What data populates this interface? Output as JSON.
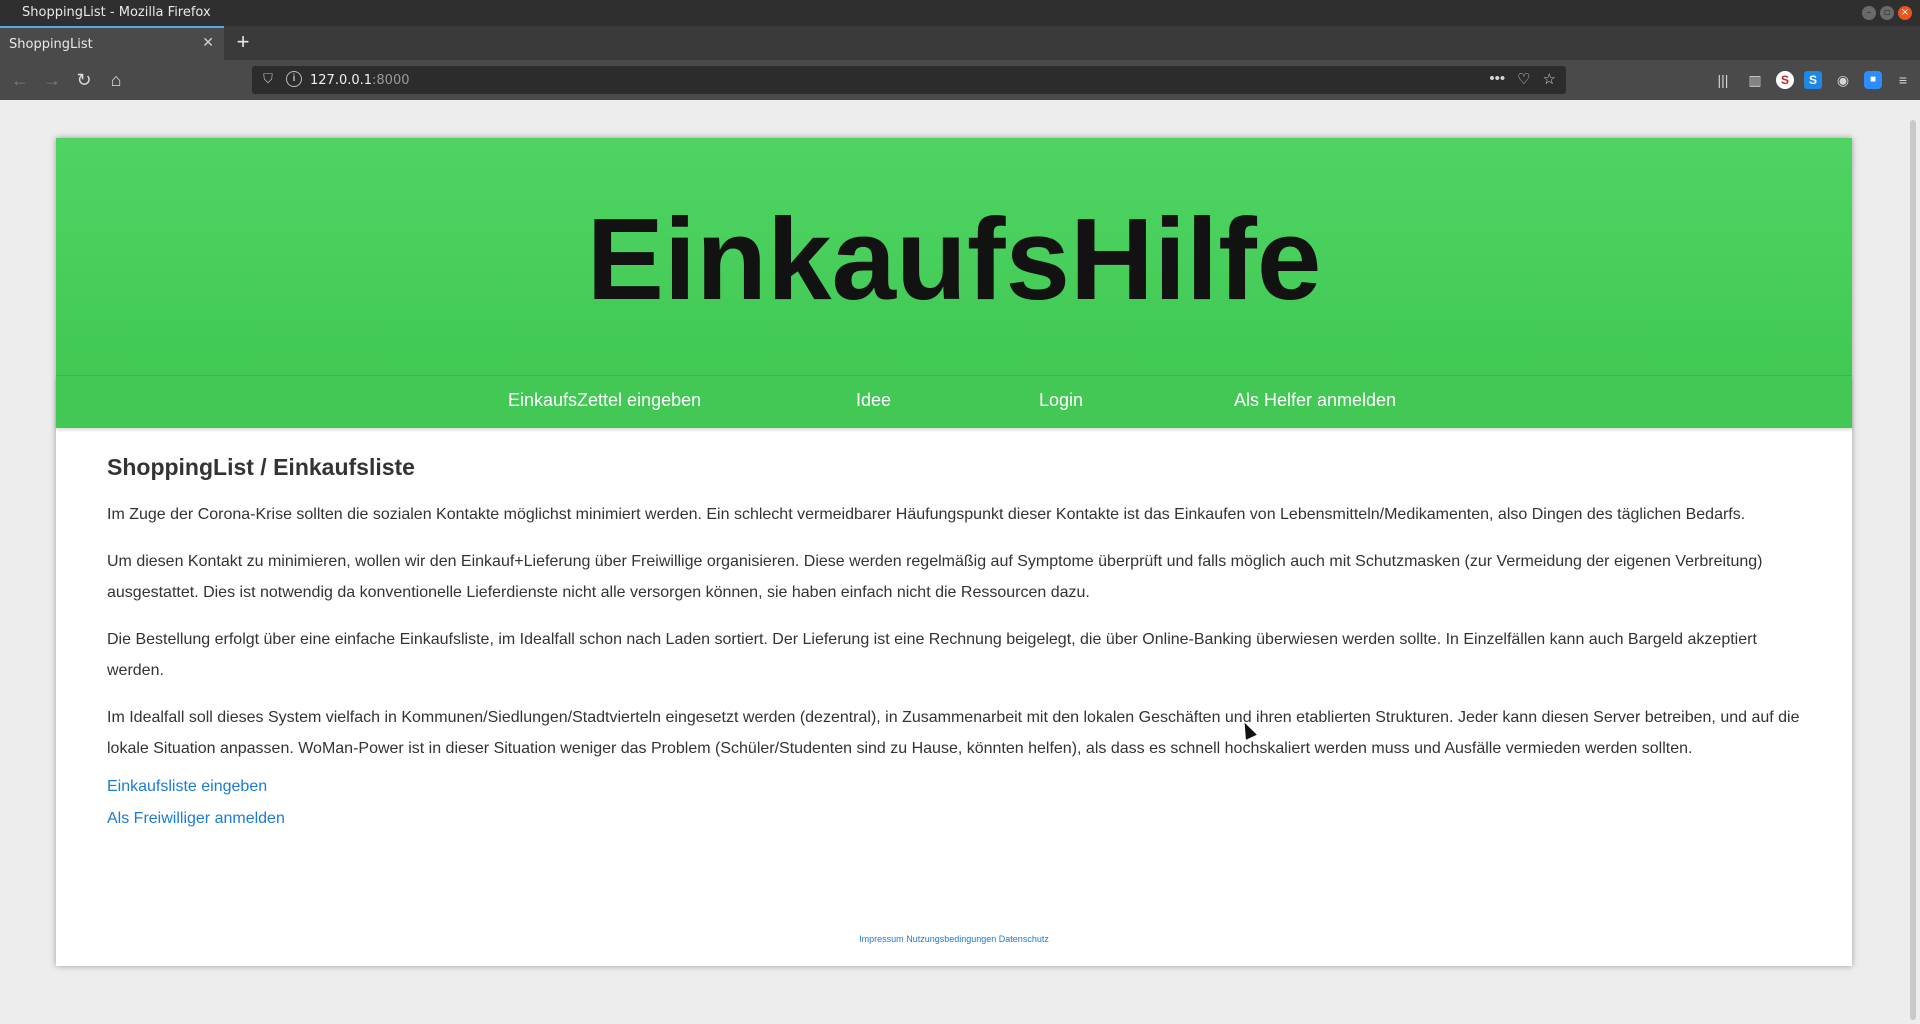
{
  "window": {
    "title": "ShoppingList - Mozilla Firefox"
  },
  "tab": {
    "title": "ShoppingList",
    "close": "✕"
  },
  "newtab": "+",
  "nav": {
    "back": "←",
    "forward": "→",
    "reload": "↻",
    "home": "⌂"
  },
  "url": {
    "host": "127.0.0.1",
    "port": ":8000"
  },
  "url_actions": {
    "more": "•••",
    "pocket": "♡",
    "bookmark": "☆"
  },
  "hero": {
    "title": "EinkaufsHilfe"
  },
  "menu": [
    {
      "label": "EinkaufsZettel eingeben"
    },
    {
      "label": "Idee"
    },
    {
      "label": "Login"
    },
    {
      "label": "Als Helfer anmelden"
    }
  ],
  "main": {
    "heading": "ShoppingList / Einkaufsliste",
    "paragraphs": [
      "Im Zuge der Corona-Krise sollten die sozialen Kontakte möglichst minimiert werden. Ein schlecht vermeidbarer Häufungspunkt dieser Kontakte ist das Einkaufen von Lebensmitteln/Medikamenten, also Dingen des täglichen Bedarfs.",
      "Um diesen Kontakt zu minimieren, wollen wir den Einkauf+Lieferung über Freiwillige organisieren. Diese werden regelmäßig auf Symptome überprüft und falls möglich auch mit Schutzmasken (zur Vermeidung der eigenen Verbreitung) ausgestattet. Dies ist notwendig da konventionelle Lieferdienste nicht alle versorgen können, sie haben einfach nicht die Ressourcen dazu.",
      "Die Bestellung erfolgt über eine einfache Einkaufsliste, im Idealfall schon nach Laden sortiert. Der Lieferung ist eine Rechnung beigelegt, die über Online-Banking überwiesen werden sollte. In Einzelfällen kann auch Bargeld akzeptiert werden.",
      "Im Idealfall soll dieses System vielfach in Kommunen/Siedlungen/Stadtvierteln eingesetzt werden (dezentral), in Zusammenarbeit mit den lokalen Geschäften und ihren etablierten Strukturen. Jeder kann diesen Server betreiben, und auf die lokale Situation anpassen. WoMan-Power ist in dieser Situation weniger das Problem (Schüler/Studenten sind zu Hause, könnten helfen), als dass es schnell hochskaliert werden muss und Ausfälle vermieden werden sollten."
    ],
    "links": [
      "Einkaufsliste eingeben",
      "Als Freiwilliger anmelden"
    ]
  },
  "footer": {
    "impressum": "Impressum",
    "nutzung": "Nutzungsbedingungen",
    "datenschutz": "Datenschutz"
  },
  "colors": {
    "hero_green": "#4fd463",
    "menu_green": "#43c856",
    "link_blue": "#1a7cd6"
  }
}
